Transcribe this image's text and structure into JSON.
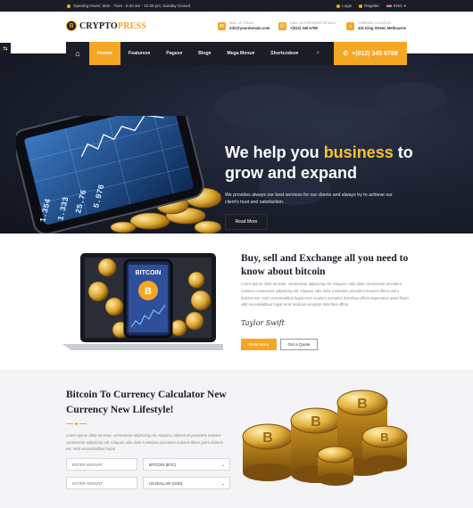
{
  "topbar": {
    "hours": "Opening Hours: Mon - Tues : 6.00 am - 10.00 pm, Sunday Closed",
    "login": "Login",
    "register": "Register",
    "language": "ENG"
  },
  "brand": {
    "logo_main": "CRYPTO",
    "logo_accent": "PRESS",
    "logo_letter": "B"
  },
  "contacts": [
    {
      "label": "MAIL US TODAY",
      "value": "info@yourdomain.com"
    },
    {
      "label": "CALL US FOR MORE DETAILS",
      "value": "+(012) 345 6789"
    },
    {
      "label": "COMPANY LOCATION",
      "value": "431 King Street, Melbourne"
    }
  ],
  "nav": {
    "items": [
      "Home",
      "Features",
      "Pages",
      "Blog",
      "Mega Menu",
      "Shortcodes"
    ],
    "active": "Home",
    "phone": "+(012) 345 6789"
  },
  "hero": {
    "title_pre": "We help you ",
    "title_highlight": "business",
    "title_post": " to grow and expand",
    "subtitle": "We provides always our best services for our clients and always try to achieve our client's trust and satisfaction.",
    "button": "Read More"
  },
  "exchange": {
    "title": "Buy, sell and Exchange all you need to know about bitcoin",
    "paragraph": "Lorem ipsum dolor sit amet, consectetur adipiscing elit. Aliquam, odio dolor consectetur provident maiores consectetur adipiscing elit. Aliquam odio dolor runtesseu provident maiores libero porro doloren est. Velit necessitatibus fugiat error incidunt excepturi doloribus officia aspernatur quasi libero velit necessitatibus fugiat error incidunt excepturi doloribus officia",
    "signature": "Taylor Swift",
    "btn_primary": "Read More",
    "btn_secondary": "Get a Quote",
    "laptop_label": "BITCOIN"
  },
  "calculator": {
    "title": "Bitcoin To Currency Calculator New Currency New Lifestyle!",
    "paragraph": "Lorem ipsum dolor sit amet, consectetur adipiscing elit. Aliquam, odiorerunt provident maiores consectetur adipiscing elit. Aliquam odio dolor runtesseu provident maiores libero porro doloren est. Velit necessitatibus fugiat",
    "amount_placeholder_1": "ENTER AMOUNT",
    "currency_1": "BITCOIN (BTC)",
    "amount_placeholder_2": "ENTER AMOUNT",
    "currency_2": "US DOLLAR (USD)"
  },
  "hero_phone_numbers": [
    "1.354",
    "1.333",
    "25.76",
    "5.976"
  ],
  "colors": {
    "accent": "#f5a623",
    "dark": "#1b1d26",
    "highlight": "#f5c430"
  }
}
